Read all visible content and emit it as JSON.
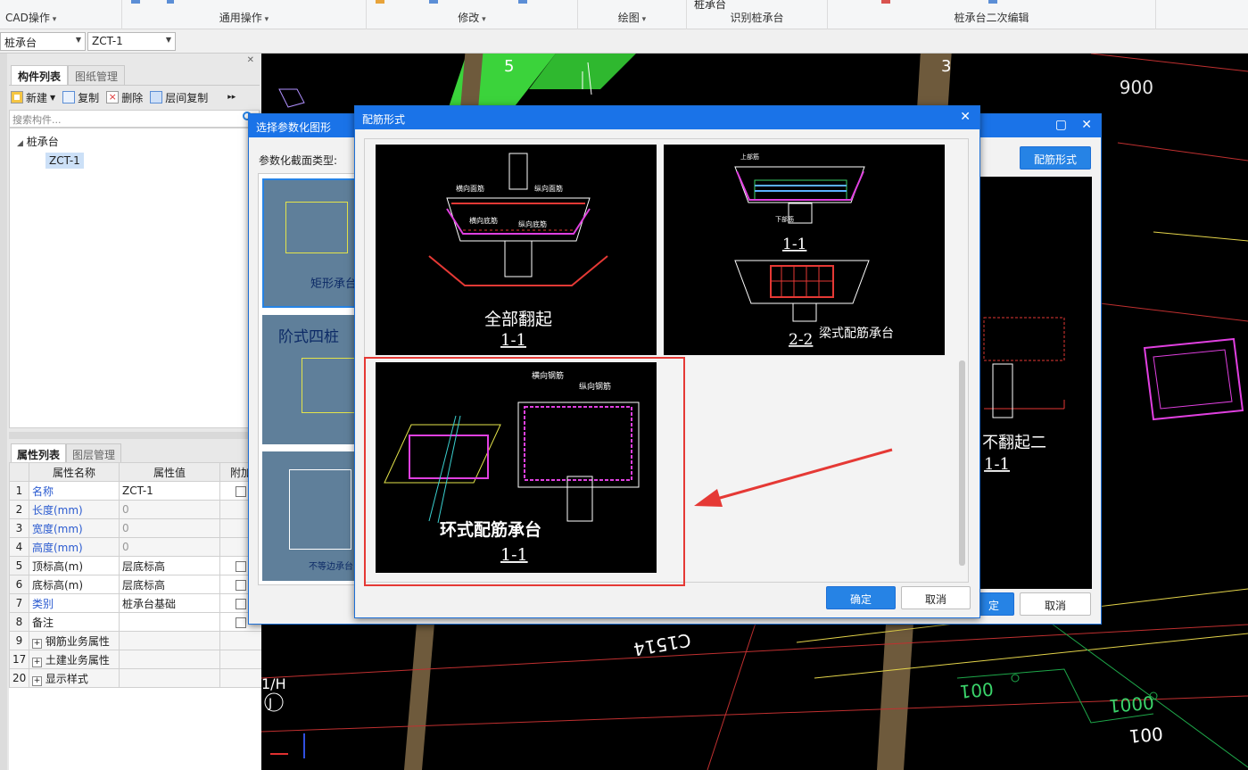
{
  "ribbon": {
    "groups": [
      {
        "label": "CAD操作"
      },
      {
        "label": "通用操作"
      },
      {
        "label": "修改"
      },
      {
        "label": "绘图"
      },
      {
        "label": "识别桩承台",
        "top_text": "桩承台"
      },
      {
        "label": "桩承台二次编辑"
      }
    ]
  },
  "combos": {
    "type": "桩承台",
    "name": "ZCT-1"
  },
  "component_panel": {
    "tabs": [
      "构件列表",
      "图纸管理"
    ],
    "toolbar": {
      "new": "新建",
      "copy": "复制",
      "delete": "删除",
      "floor_copy": "层间复制"
    },
    "search_placeholder": "搜索构件...",
    "tree": {
      "root": "桩承台",
      "child": "ZCT-1"
    }
  },
  "property_panel": {
    "tabs": [
      "属性列表",
      "图层管理"
    ],
    "headers": [
      "属性名称",
      "属性值",
      "附加"
    ],
    "rows": [
      {
        "num": "1",
        "name": "名称",
        "value": "ZCT-1"
      },
      {
        "num": "2",
        "name": "长度(mm)",
        "value": "0"
      },
      {
        "num": "3",
        "name": "宽度(mm)",
        "value": "0"
      },
      {
        "num": "4",
        "name": "高度(mm)",
        "value": "0"
      },
      {
        "num": "5",
        "name": "顶标高(m)",
        "value": "层底标高"
      },
      {
        "num": "6",
        "name": "底标高(m)",
        "value": "层底标高"
      },
      {
        "num": "7",
        "name": "类别",
        "value": "桩承台基础"
      },
      {
        "num": "8",
        "name": "备注",
        "value": ""
      },
      {
        "num": "9",
        "name": "钢筋业务属性",
        "value": ""
      },
      {
        "num": "17",
        "name": "土建业务属性",
        "value": ""
      },
      {
        "num": "20",
        "name": "显示样式",
        "value": ""
      }
    ]
  },
  "cad": {
    "axis_labels": [
      "5",
      "3",
      "1/H",
      "J"
    ],
    "mirrored_texts": [
      "C1514",
      "0001",
      "001",
      "001",
      "006"
    ]
  },
  "param_dialog": {
    "title": "选择参数化图形",
    "section_label": "参数化截面类型:",
    "button_rebar": "配筋形式",
    "ok": "定",
    "cancel": "取消",
    "thumbs": [
      "矩形承台",
      "阶式四桩",
      "不等边承台"
    ],
    "preview_text": "不翻起二",
    "preview_sub": "1-1"
  },
  "rebar_dialog": {
    "title": "配筋形式",
    "ok": "确定",
    "cancel": "取消",
    "options": [
      {
        "name": "全部翻起",
        "sub": "1-1"
      },
      {
        "name": "梁式配筋承台",
        "sub": "1-1",
        "sub2": "2-2"
      },
      {
        "name": "环式配筋承台",
        "sub": "1-1"
      }
    ],
    "annotations": {
      "transverse_top": "横向面筋",
      "longitudinal_top": "纵向面筋",
      "transverse_bottom": "横向底筋",
      "longitudinal_bottom": "纵向底筋",
      "transverse_rebar": "横向钢筋",
      "longitudinal_rebar": "纵向钢筋",
      "top_rebar": "上部筋",
      "bottom_rebar": "下部筋"
    }
  },
  "colors": {
    "accent": "#1a73e8",
    "highlight": "#e53935",
    "cad_bg": "#000000"
  }
}
